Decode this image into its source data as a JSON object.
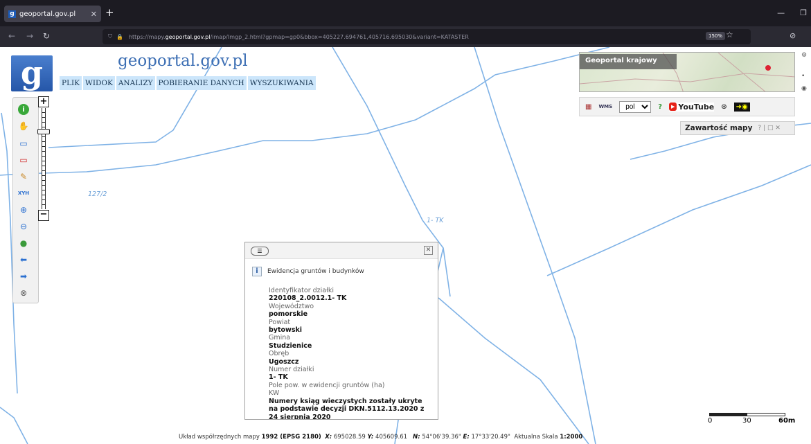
{
  "browser": {
    "tab_title": "geoportal.gov.pl",
    "tab_favicon": "g",
    "url_prefix": "https://mapy.",
    "url_domain": "geoportal.gov.pl",
    "url_rest": "/imap/Imgp_2.html?gpmap=gp0&bbox=405227.694761,405716.695030&variant=KATASTER",
    "zoom": "150%"
  },
  "header": {
    "logo_letter": "g",
    "site_title": "geoportal.gov.pl"
  },
  "menu": [
    "PLIK",
    "WIDOK",
    "ANALIZY",
    "POBIERANIE DANYCH",
    "WYSZUKIWANIA"
  ],
  "minimap": {
    "label": "Geoportal krajowy"
  },
  "toolbar_right": {
    "language": "pol",
    "youtube_label": "YouTube"
  },
  "map_contents": {
    "title": "Zawartość mapy",
    "buttons": "? | □ ✕"
  },
  "map_labels": {
    "parcel_a": "127/2",
    "parcel_b": "1- TK"
  },
  "popup": {
    "heading": "Ewidencja gruntów i budynków",
    "fields": [
      {
        "label": "Identyfikator działki",
        "value": "220108_2.0012.1- TK"
      },
      {
        "label": "Województwo",
        "value": "pomorskie"
      },
      {
        "label": "Powiat",
        "value": "bytowski"
      },
      {
        "label": "Gmina",
        "value": "Studzienice"
      },
      {
        "label": "Obręb",
        "value": "Ugoszcz"
      },
      {
        "label": "Numer działki",
        "value": "1- TK"
      },
      {
        "label": "Pole pow. w ewidencji gruntów (ha)",
        "value": ""
      },
      {
        "label": "KW",
        "value": "Numery ksiąg wieczystych zostały ukryte na podstawie decyzji DKN.5112.13.2020 z 24 sierpnia 2020"
      }
    ]
  },
  "statusbar": {
    "prefix": "Układ współrzędnych mapy",
    "crs": "1992 (EPSG 2180)",
    "x_label": "X:",
    "x": "695028.59",
    "y_label": "Y:",
    "y": "405609.61",
    "n_label": "N:",
    "n": "54°06'39.36\"",
    "e_label": "E:",
    "e": "17°33'20.49\"",
    "scale_label": "Aktualna Skala",
    "scale": "1:2000"
  },
  "scalebar": {
    "t0": "0",
    "t1": "30",
    "t2": "60m"
  },
  "colors": {
    "parcel_line": "#7fb2e6",
    "menu_bg": "#cce6fb",
    "logo_bg": "#2d62b3"
  }
}
